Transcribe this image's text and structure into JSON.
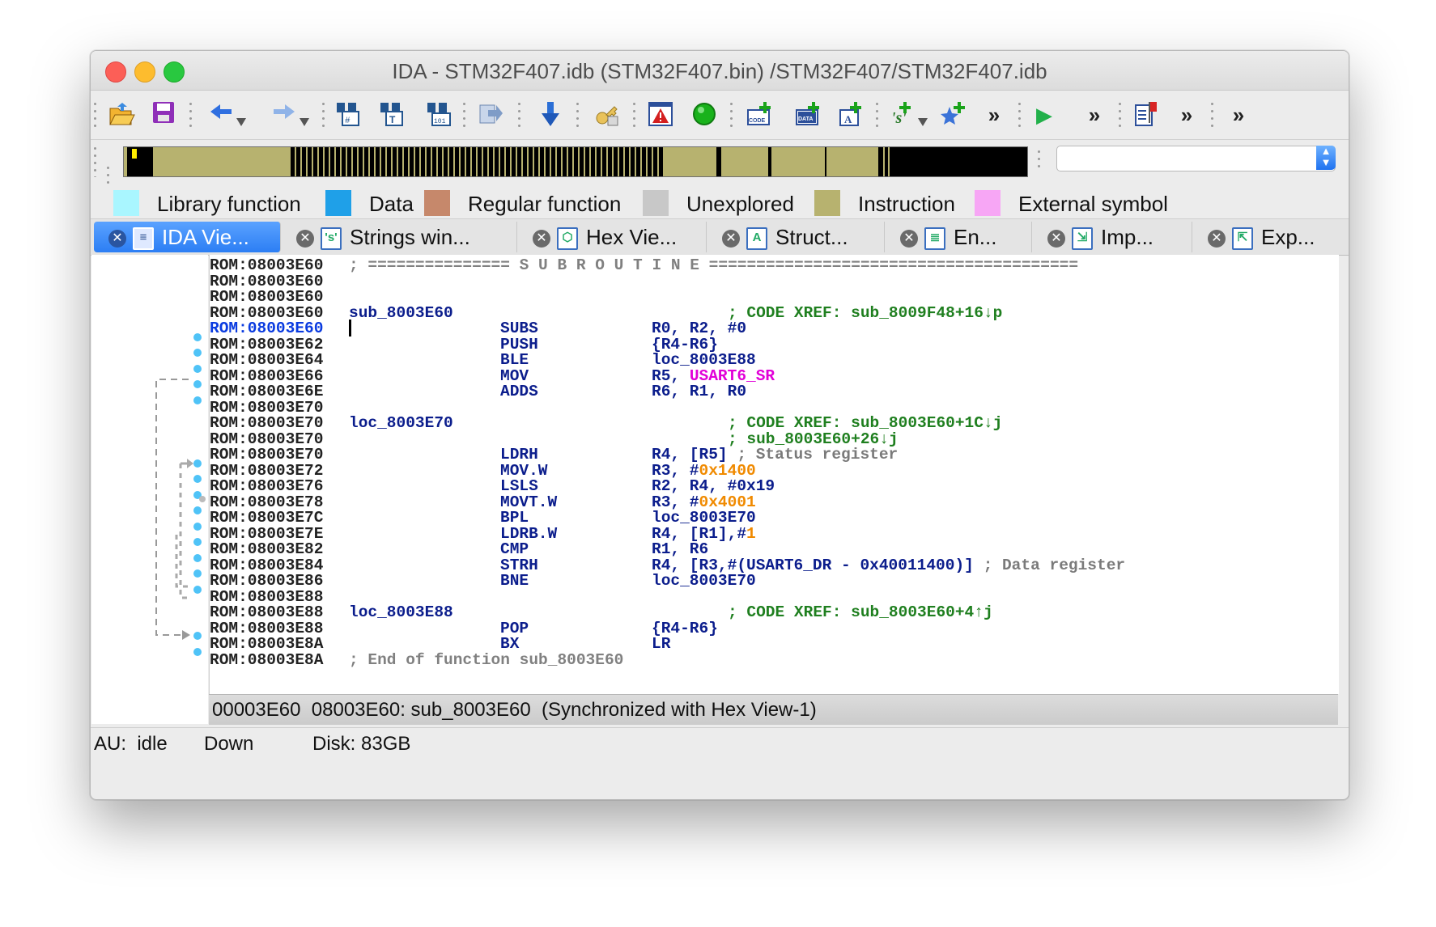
{
  "window": {
    "title": "IDA - STM32F407.idb (STM32F407.bin) /STM32F407/STM32F407.idb"
  },
  "toolbar": {
    "items": [
      "open-folder-icon",
      "save-icon",
      "back-arrow-icon",
      "forward-arrow-icon",
      "search-hex-icon",
      "search-text-icon",
      "search-binary-icon",
      "jump-icon",
      "down-arrow-icon",
      "key-icon",
      "warning-icon",
      "green-circle-icon",
      "code-icon",
      "data-icon",
      "string-icon",
      "struct-icon",
      "star-icon",
      "more-icon",
      "play-icon",
      "more-icon",
      "flag-icon",
      "more-icon"
    ],
    "more_glyph": "»",
    "play_glyph": "▶"
  },
  "legend": [
    {
      "label": "Library function",
      "color": "#a9f6ff"
    },
    {
      "label": "Data",
      "color": "#1fa0e8"
    },
    {
      "label": "Regular function",
      "color": "#c6886b"
    },
    {
      "label": "Unexplored",
      "color": "#c8c8c8"
    },
    {
      "label": "Instruction",
      "color": "#b7b26f"
    },
    {
      "label": "External symbol",
      "color": "#f7a6f5"
    }
  ],
  "tabs": [
    {
      "label": "IDA Vie...",
      "icon": "ida-view-icon",
      "active": true
    },
    {
      "label": "Strings win...",
      "icon": "strings-icon",
      "active": false
    },
    {
      "label": "Hex Vie...",
      "icon": "hex-view-icon",
      "active": false
    },
    {
      "label": "Struct...",
      "icon": "structures-icon",
      "active": false
    },
    {
      "label": "En...",
      "icon": "enums-icon",
      "active": false
    },
    {
      "label": "Imp...",
      "icon": "imports-icon",
      "active": false
    },
    {
      "label": "Exp...",
      "icon": "exports-icon",
      "active": false
    }
  ],
  "listing": {
    "subroutine_banner": "; =============== S U B R O U T I N E =======================================",
    "lines": [
      {
        "addr": "ROM:08003E60",
        "kind": "banner"
      },
      {
        "addr": "ROM:08003E60"
      },
      {
        "addr": "ROM:08003E60"
      },
      {
        "addr": "ROM:08003E60",
        "label": "sub_8003E60",
        "comment": "; CODE XREF: sub_8009F48+16↓p"
      },
      {
        "addr": "ROM:08003E60",
        "current": true,
        "mnem": "SUBS",
        "ops": "R0, R2, #0"
      },
      {
        "addr": "ROM:08003E62",
        "mnem": "PUSH",
        "ops": "{R4-R6}"
      },
      {
        "addr": "ROM:08003E64",
        "mnem": "BLE",
        "ops": "loc_8003E88"
      },
      {
        "addr": "ROM:08003E66",
        "mnem": "MOV",
        "ops_pre": "R5, ",
        "ops_mag": "USART6_SR"
      },
      {
        "addr": "ROM:08003E6E",
        "mnem": "ADDS",
        "ops": "R6, R1, R0"
      },
      {
        "addr": "ROM:08003E70"
      },
      {
        "addr": "ROM:08003E70",
        "label": "loc_8003E70",
        "comment": "; CODE XREF: sub_8003E60+1C↓j"
      },
      {
        "addr": "ROM:08003E70",
        "comment": "; sub_8003E60+26↓j"
      },
      {
        "addr": "ROM:08003E70",
        "mnem": "LDRH",
        "ops": "R4, [R5]",
        "tail_comment": " ; Status register"
      },
      {
        "addr": "ROM:08003E72",
        "mnem": "MOV.W",
        "ops_pre": "R3, #",
        "ops_ora": "0x1400"
      },
      {
        "addr": "ROM:08003E76",
        "mnem": "LSLS",
        "ops": "R2, R4, #0x19"
      },
      {
        "addr": "ROM:08003E78",
        "mnem": "MOVT.W",
        "ops_pre": "R3, #",
        "ops_ora": "0x4001"
      },
      {
        "addr": "ROM:08003E7C",
        "mnem": "BPL",
        "ops": "loc_8003E70"
      },
      {
        "addr": "ROM:08003E7E",
        "mnem": "LDRB.W",
        "ops_pre": "R4, [R1],#",
        "ops_ora": "1"
      },
      {
        "addr": "ROM:08003E82",
        "mnem": "CMP",
        "ops": "R1, R6"
      },
      {
        "addr": "ROM:08003E84",
        "mnem": "STRH",
        "ops": "R4, [R3,#(USART6_DR - 0x40011400)]",
        "tail_comment": " ; Data register"
      },
      {
        "addr": "ROM:08003E86",
        "mnem": "BNE",
        "ops": "loc_8003E70"
      },
      {
        "addr": "ROM:08003E88"
      },
      {
        "addr": "ROM:08003E88",
        "label": "loc_8003E88",
        "comment": "; CODE XREF: sub_8003E60+4↑j"
      },
      {
        "addr": "ROM:08003E88",
        "mnem": "POP",
        "ops": "{R4-R6}"
      },
      {
        "addr": "ROM:08003E8A",
        "mnem": "BX",
        "ops": "LR"
      },
      {
        "addr": "ROM:08003E8A",
        "kind": "end",
        "text": "; End of function sub_8003E60"
      }
    ]
  },
  "status_line": "00003E60  08003E60: sub_8003E60  (Synchronized with Hex View-1)",
  "bottom": {
    "au": "AU:  idle",
    "direction": "Down",
    "disk": "Disk: 83GB"
  }
}
